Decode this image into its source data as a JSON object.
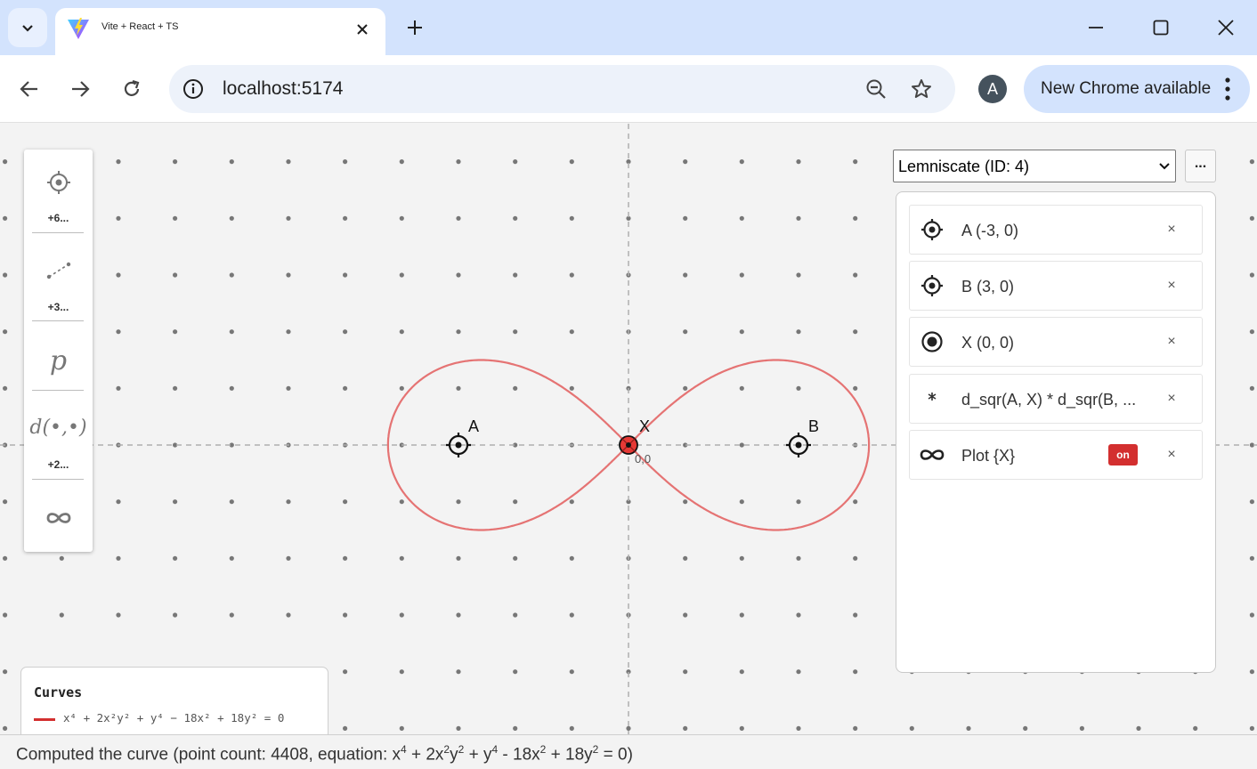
{
  "browser": {
    "tab_title": "Vite + React + TS",
    "url": "localhost:5174",
    "profile_initial": "A",
    "update_button_label": "New Chrome available",
    "icons": [
      "tab-search-icon",
      "vite-favicon",
      "close-icon",
      "plus-icon",
      "minimize-icon",
      "maximize-icon",
      "close-window-icon",
      "back-arrow-icon",
      "forward-arrow-icon",
      "reload-icon",
      "site-info-icon",
      "zoom-out-icon",
      "bookmark-star-icon",
      "kebab-menu-icon"
    ]
  },
  "palette": {
    "point_more": "+6...",
    "line_more": "+3...",
    "param_label": "p",
    "distance_label": "d(•,•)",
    "distance_more": "+2..."
  },
  "canvas": {
    "curve_color": "#e57373",
    "point_labels": {
      "A": "A",
      "B": "B",
      "X": "X"
    },
    "x_coord_label": "0,0"
  },
  "object_panel": {
    "selected": "Lemniscate (ID: 4)",
    "more_label": "...",
    "rows": [
      {
        "icon": "crosshair-point-icon",
        "label": "A (-3, 0)",
        "close": "×"
      },
      {
        "icon": "crosshair-point-icon",
        "label": "B (3, 0)",
        "close": "×"
      },
      {
        "icon": "free-point-icon",
        "label": "X (0, 0)",
        "close": "×"
      },
      {
        "icon": "asterisk-icon",
        "label": "d_sqr(A, X) * d_sqr(B, ...",
        "close": "×"
      },
      {
        "icon": "infinity-icon",
        "label": "Plot {X}",
        "toggle": "on",
        "close": "×"
      }
    ]
  },
  "curves": {
    "title": "Curves",
    "color": "#d32f2f",
    "equation": "x⁴ + 2x²y² + y⁴ − 18x² + 18y² = 0"
  },
  "status": {
    "prefix": "Computed the curve (point count: 4408, equation: x",
    "sup": "4",
    "mid1": " + 2x",
    "mid2": "y",
    "mid3": " + y",
    "mid4": " - 18x",
    "mid5": " + 18y",
    "suffix": " = 0)",
    "sup2": "2"
  }
}
